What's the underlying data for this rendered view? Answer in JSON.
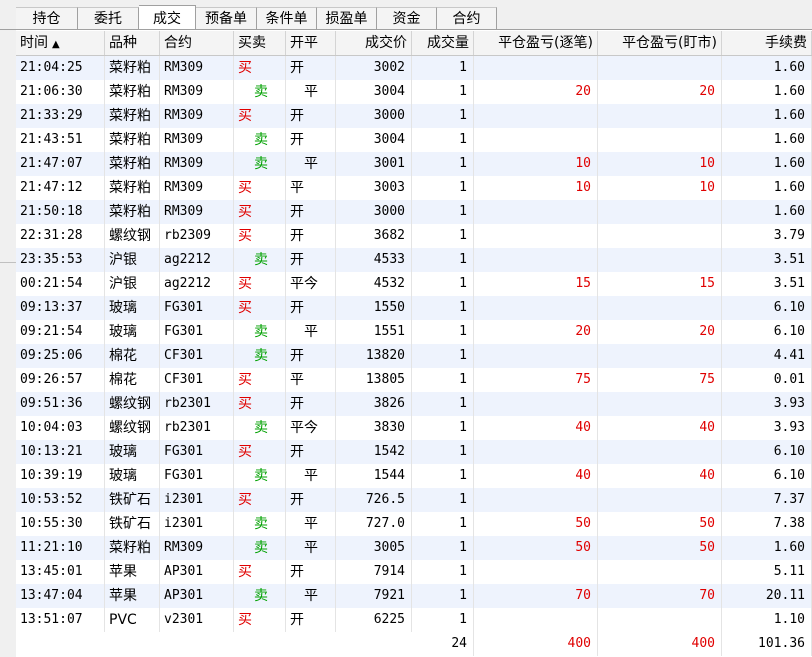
{
  "tabs": [
    {
      "label": "持仓",
      "active": false
    },
    {
      "label": "委托",
      "active": false
    },
    {
      "label": "成交",
      "active": true
    },
    {
      "label": "预备单",
      "active": false
    },
    {
      "label": "条件单",
      "active": false
    },
    {
      "label": "损盈单",
      "active": false
    },
    {
      "label": "资金",
      "active": false
    },
    {
      "label": "合约",
      "active": false
    }
  ],
  "columns": [
    "时间",
    "品种",
    "合约",
    "买卖",
    "开平",
    "成交价",
    "成交量",
    "平仓盈亏(逐笔)",
    "平仓盈亏(盯市)",
    "手续费"
  ],
  "sort_indicator": "▲",
  "colors": {
    "buy": "#e00000",
    "sell": "#00a000",
    "pnl": "#e00000",
    "row_alt": "#eef3fd"
  },
  "rows": [
    [
      "21:04:25",
      "菜籽粕",
      "RM309",
      "买",
      "开",
      "3002",
      "1",
      "",
      "",
      "1.60"
    ],
    [
      "21:06:30",
      "菜籽粕",
      "RM309",
      "卖",
      "平",
      "3004",
      "1",
      "20",
      "20",
      "1.60"
    ],
    [
      "21:33:29",
      "菜籽粕",
      "RM309",
      "买",
      "开",
      "3000",
      "1",
      "",
      "",
      "1.60"
    ],
    [
      "21:43:51",
      "菜籽粕",
      "RM309",
      "卖",
      "开",
      "3004",
      "1",
      "",
      "",
      "1.60"
    ],
    [
      "21:47:07",
      "菜籽粕",
      "RM309",
      "卖",
      "平",
      "3001",
      "1",
      "10",
      "10",
      "1.60"
    ],
    [
      "21:47:12",
      "菜籽粕",
      "RM309",
      "买",
      "平",
      "3003",
      "1",
      "10",
      "10",
      "1.60"
    ],
    [
      "21:50:18",
      "菜籽粕",
      "RM309",
      "买",
      "开",
      "3000",
      "1",
      "",
      "",
      "1.60"
    ],
    [
      "22:31:28",
      "螺纹钢",
      "rb2309",
      "买",
      "开",
      "3682",
      "1",
      "",
      "",
      "3.79"
    ],
    [
      "23:35:53",
      "沪银",
      "ag2212",
      "卖",
      "开",
      "4533",
      "1",
      "",
      "",
      "3.51"
    ],
    [
      "00:21:54",
      "沪银",
      "ag2212",
      "买",
      "平今",
      "4532",
      "1",
      "15",
      "15",
      "3.51"
    ],
    [
      "09:13:37",
      "玻璃",
      "FG301",
      "买",
      "开",
      "1550",
      "1",
      "",
      "",
      "6.10"
    ],
    [
      "09:21:54",
      "玻璃",
      "FG301",
      "卖",
      "平",
      "1551",
      "1",
      "20",
      "20",
      "6.10"
    ],
    [
      "09:25:06",
      "棉花",
      "CF301",
      "卖",
      "开",
      "13820",
      "1",
      "",
      "",
      "4.41"
    ],
    [
      "09:26:57",
      "棉花",
      "CF301",
      "买",
      "平",
      "13805",
      "1",
      "75",
      "75",
      "0.01"
    ],
    [
      "09:51:36",
      "螺纹钢",
      "rb2301",
      "买",
      "开",
      "3826",
      "1",
      "",
      "",
      "3.93"
    ],
    [
      "10:04:03",
      "螺纹钢",
      "rb2301",
      "卖",
      "平今",
      "3830",
      "1",
      "40",
      "40",
      "3.93"
    ],
    [
      "10:13:21",
      "玻璃",
      "FG301",
      "买",
      "开",
      "1542",
      "1",
      "",
      "",
      "6.10"
    ],
    [
      "10:39:19",
      "玻璃",
      "FG301",
      "卖",
      "平",
      "1544",
      "1",
      "40",
      "40",
      "6.10"
    ],
    [
      "10:53:52",
      "铁矿石",
      "i2301",
      "买",
      "开",
      "726.5",
      "1",
      "",
      "",
      "7.37"
    ],
    [
      "10:55:30",
      "铁矿石",
      "i2301",
      "卖",
      "平",
      "727.0",
      "1",
      "50",
      "50",
      "7.38"
    ],
    [
      "11:21:10",
      "菜籽粕",
      "RM309",
      "卖",
      "平",
      "3005",
      "1",
      "50",
      "50",
      "1.60"
    ],
    [
      "13:45:01",
      "苹果",
      "AP301",
      "买",
      "开",
      "7914",
      "1",
      "",
      "",
      "5.11"
    ],
    [
      "13:47:04",
      "苹果",
      "AP301",
      "卖",
      "平",
      "7921",
      "1",
      "70",
      "70",
      "20.11"
    ],
    [
      "13:51:07",
      "PVC",
      "v2301",
      "买",
      "开",
      "6225",
      "1",
      "",
      "",
      "1.10"
    ]
  ],
  "totals": {
    "volume": "24",
    "pnl_trade": "400",
    "pnl_mtm": "400",
    "fee": "101.36"
  }
}
